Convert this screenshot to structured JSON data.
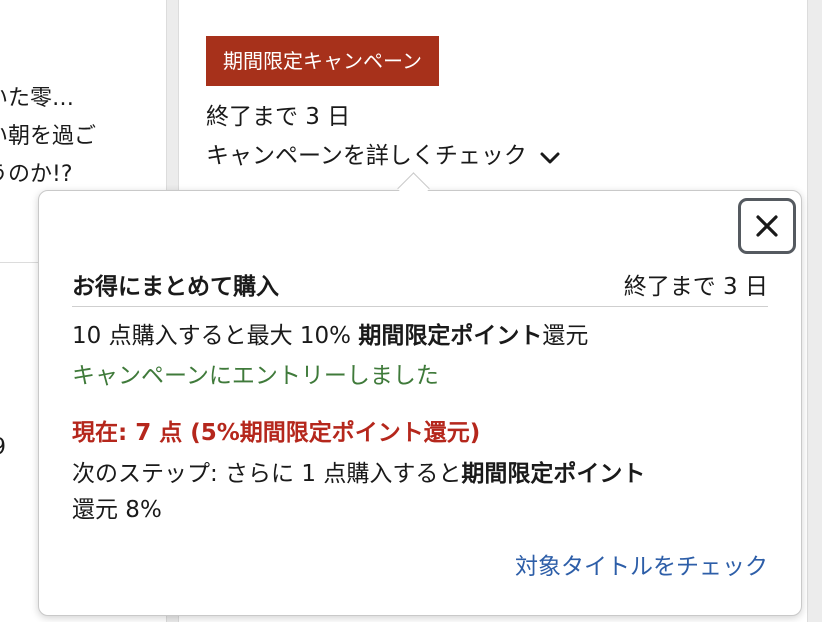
{
  "left_column": {
    "snippet_lines": [
      "いた零…",
      "い朝を過ご",
      "うのか!?"
    ],
    "partial_digit": "9"
  },
  "campaign": {
    "badge": "期間限定キャンペーン",
    "days_left": "終了まで 3 日",
    "details_toggle": "キャンペーンを詳しくチェック",
    "badge_color": "#a7311b"
  },
  "popover": {
    "close_icon": "close-icon",
    "title": "お得にまとめて購入",
    "days_left": "終了まで 3 日",
    "offer": {
      "prefix": "10 点購入すると最大 10% ",
      "bold": "期間限定ポイント",
      "suffix": "還元"
    },
    "entry_status": "キャンペーンにエントリーしました",
    "current_status": "現在: 7 点 (5%期間限定ポイント還元)",
    "next_step": {
      "prefix": "次のステップ: さらに 1 点購入すると",
      "bold": "期間限定ポイント",
      "suffix": "還元 8%"
    },
    "link": "対象タイトルをチェック",
    "colors": {
      "entry_status": "#3f7a3a",
      "current_status": "#b5271c",
      "link": "#2d5ea8"
    }
  }
}
